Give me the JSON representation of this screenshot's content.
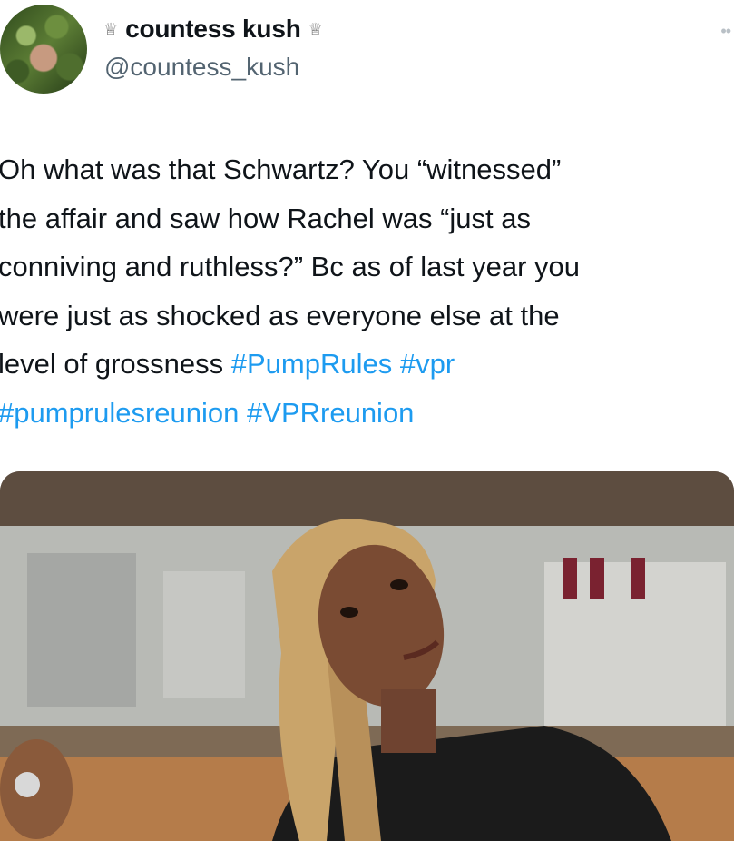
{
  "author": {
    "display_name": "countess kush",
    "crown_glyph_left": "♕",
    "crown_glyph_right": "♕",
    "handle": "@countess_kush",
    "avatar_icon": "profile-photo"
  },
  "more_icon": "more-dots-icon",
  "tweet": {
    "text_segments": [
      "Oh what was that Schwartz? You “witnessed”",
      "the affair and saw how Rachel was “just as",
      "conniving and ruthless?” Bc as of last year you",
      "were just as shocked as everyone else at the",
      "level of grossness "
    ],
    "hashtags": [
      "#PumpRules",
      "#vpr",
      "#pumprulesreunion",
      "#VPRreunion"
    ]
  },
  "media": {
    "type": "gif-still",
    "description_icon": "woman-head-tilt-image"
  },
  "colors": {
    "text": "#0f1419",
    "secondary": "#536471",
    "link": "#1d9bf0",
    "background": "#ffffff"
  }
}
